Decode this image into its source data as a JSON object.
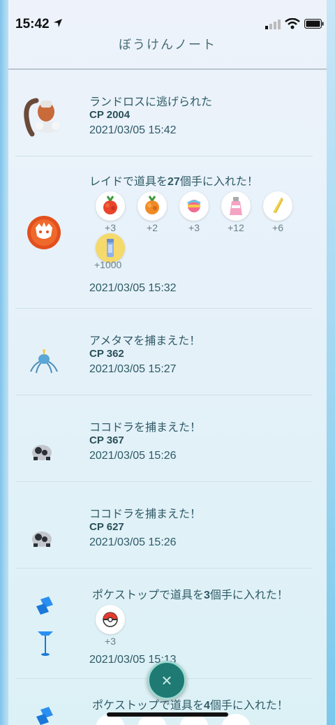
{
  "status": {
    "time": "15:42"
  },
  "header": {
    "title": "ぼうけんノート"
  },
  "entries": [
    {
      "title": "ランドロスに逃げられた",
      "cp": "CP 2004",
      "timestamp": "2021/03/05 15:42"
    },
    {
      "title_pre": "レイドで道具を",
      "title_num": "27",
      "title_post": "個手に入れた！",
      "items": [
        {
          "icon": "razz-berry-icon",
          "count": "+3"
        },
        {
          "icon": "golden-razz-berry-icon",
          "count": "+2"
        },
        {
          "icon": "rare-candy-icon",
          "count": "+3"
        },
        {
          "icon": "potion-icon",
          "count": "+12"
        },
        {
          "icon": "fast-tm-icon",
          "count": "+6"
        },
        {
          "icon": "stardust-icon",
          "count": "+1000"
        }
      ],
      "timestamp": "2021/03/05 15:32"
    },
    {
      "title": "アメタマを捕まえた！",
      "cp": "CP 362",
      "timestamp": "2021/03/05 15:27"
    },
    {
      "title": "ココドラを捕まえた！",
      "cp": "CP 367",
      "timestamp": "2021/03/05 15:26"
    },
    {
      "title": "ココドラを捕まえた！",
      "cp": "CP 627",
      "timestamp": "2021/03/05 15:26"
    },
    {
      "title_pre": "ポケストップで道具を",
      "title_num": "3",
      "title_post": "個手に入れた！",
      "items": [
        {
          "icon": "poke-ball-icon",
          "count": "+3"
        }
      ],
      "timestamp": "2021/03/05 15:13"
    },
    {
      "title_pre": "ポケストップで道具を",
      "title_num": "4",
      "title_post": "個手に入れた！"
    }
  ],
  "close_button": {
    "symbol": "×"
  }
}
